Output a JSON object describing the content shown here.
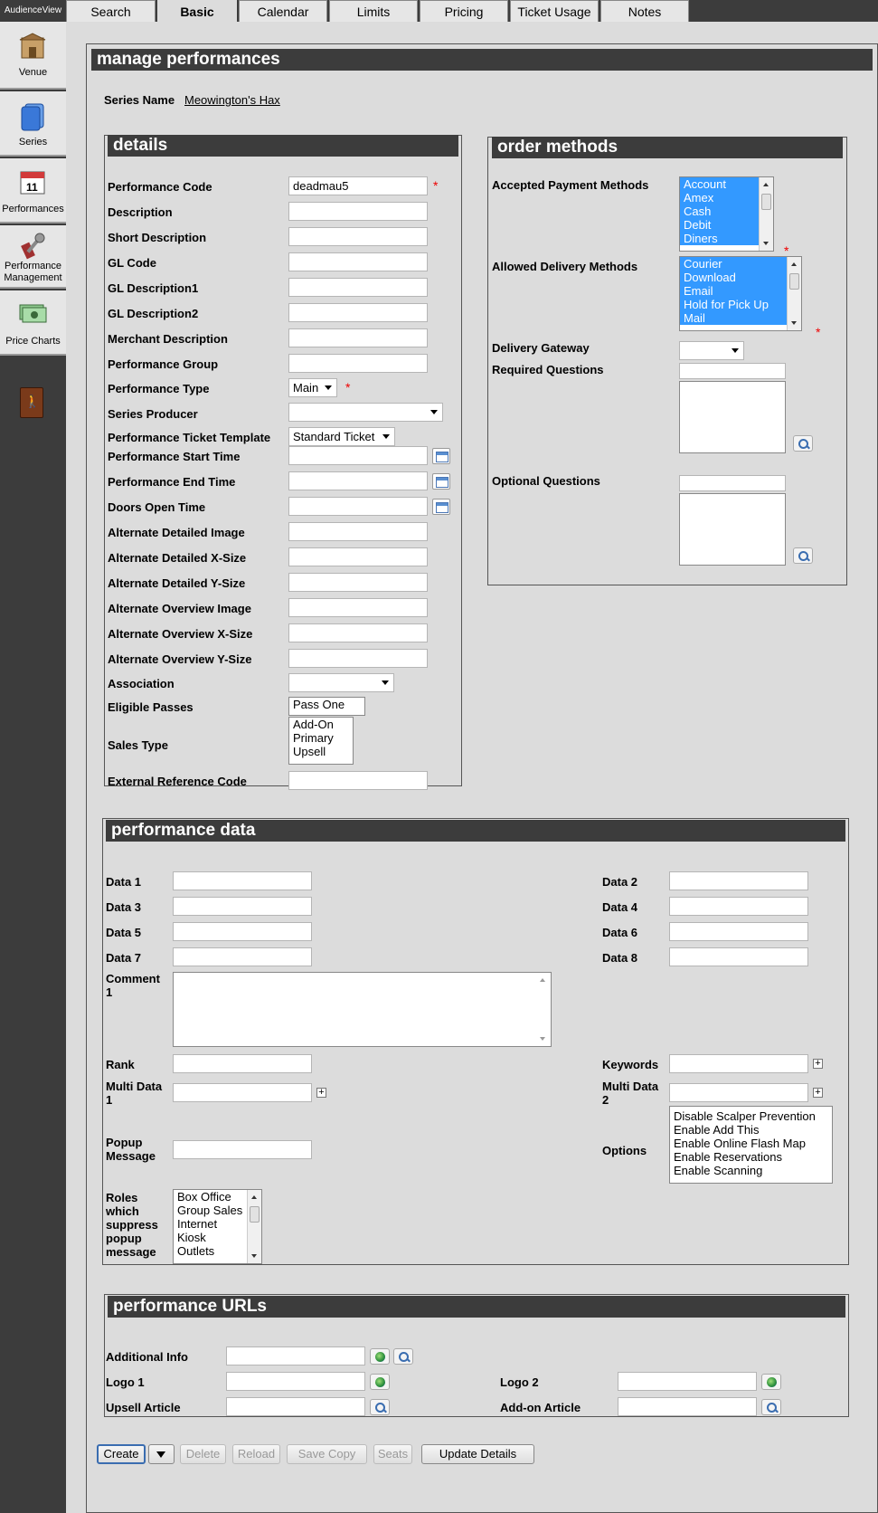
{
  "app": {
    "name": "AudienceView"
  },
  "tabs": [
    "Search",
    "Basic",
    "Calendar",
    "Limits",
    "Pricing",
    "Ticket Usage",
    "Notes"
  ],
  "sidebar": [
    {
      "label": "Venue",
      "icon": "venue-icon"
    },
    {
      "label": "Series",
      "icon": "series-icon"
    },
    {
      "label": "Performances",
      "icon": "performances-icon"
    },
    {
      "label": "Performance Management",
      "icon": "performance-management-icon"
    },
    {
      "label": "Price Charts",
      "icon": "price-charts-icon"
    }
  ],
  "page": {
    "title": "manage performances",
    "series_name_label": "Series Name",
    "series_name_value": "Meowington's Hax"
  },
  "details": {
    "title": "details",
    "performance_code": {
      "label": "Performance Code",
      "value": "deadmau5"
    },
    "description": "Description",
    "short_description": "Short Description",
    "gl_code": "GL Code",
    "gl_description1": "GL Description1",
    "gl_description2": "GL Description2",
    "merchant_description": "Merchant Description",
    "performance_group": "Performance Group",
    "performance_type": {
      "label": "Performance Type",
      "value": "Main"
    },
    "series_producer": {
      "label": "Series Producer",
      "value": ""
    },
    "ticket_template": {
      "label": "Performance Ticket Template",
      "value": "Standard Ticket"
    },
    "start_time": "Performance Start Time",
    "end_time": "Performance End Time",
    "doors_open": "Doors Open Time",
    "alt_detailed_image": "Alternate Detailed Image",
    "alt_detailed_x": "Alternate Detailed X-Size",
    "alt_detailed_y": "Alternate Detailed Y-Size",
    "alt_overview_image": "Alternate Overview Image",
    "alt_overview_x": "Alternate Overview X-Size",
    "alt_overview_y": "Alternate Overview Y-Size",
    "association": {
      "label": "Association",
      "value": ""
    },
    "eligible_passes": {
      "label": "Eligible Passes",
      "value": "Pass One"
    },
    "sales_type": {
      "label": "Sales Type",
      "options": [
        "Add-On",
        "Primary",
        "Upsell"
      ]
    },
    "external_ref": "External Reference Code"
  },
  "order_methods": {
    "title": "order methods",
    "payment": {
      "label": "Accepted Payment Methods",
      "options": [
        "Account",
        "Amex",
        "Cash",
        "Debit",
        "Diners"
      ]
    },
    "delivery": {
      "label": "Allowed Delivery Methods",
      "options": [
        "Courier",
        "Download",
        "Email",
        "Hold for Pick Up",
        "Mail"
      ]
    },
    "gateway": {
      "label": "Delivery Gateway",
      "value": ""
    },
    "required_questions": "Required Questions",
    "optional_questions": "Optional Questions"
  },
  "performance_data": {
    "title": "performance data",
    "data1": "Data 1",
    "data2": "Data 2",
    "data3": "Data 3",
    "data4": "Data 4",
    "data5": "Data 5",
    "data6": "Data 6",
    "data7": "Data 7",
    "data8": "Data 8",
    "comment1": "Comment 1",
    "rank": "Rank",
    "keywords": "Keywords",
    "multi_data1": "Multi Data 1",
    "multi_data2": "Multi Data 2",
    "popup_message": "Popup Message",
    "options": {
      "label": "Options",
      "items": [
        "Disable Scalper Prevention",
        "Enable Add This",
        "Enable Online Flash Map",
        "Enable Reservations",
        "Enable Scanning"
      ]
    },
    "roles": {
      "label": "Roles which suppress popup message",
      "items": [
        "Box Office",
        "Group Sales",
        "Internet",
        "Kiosk",
        "Outlets"
      ]
    }
  },
  "urls": {
    "title": "performance URLs",
    "additional_info": "Additional Info",
    "logo1": "Logo 1",
    "logo2": "Logo 2",
    "upsell": "Upsell Article",
    "addon": "Add-on Article"
  },
  "buttons": {
    "create": "Create",
    "delete": "Delete",
    "reload": "Reload",
    "save_copy": "Save Copy",
    "seats": "Seats",
    "update": "Update Details"
  },
  "colors": {
    "header_bg": "#3c3c3c",
    "selection": "#3399ff",
    "required": "#e00000"
  }
}
